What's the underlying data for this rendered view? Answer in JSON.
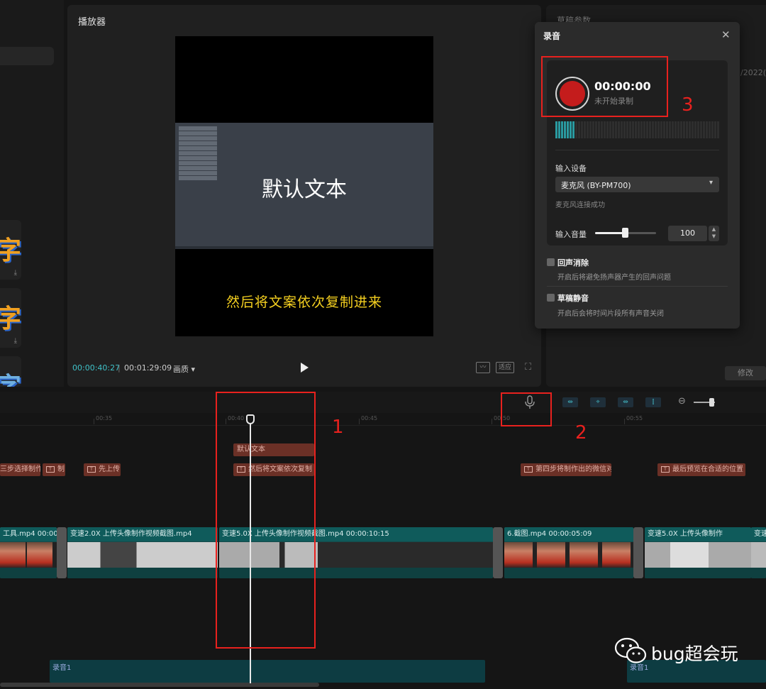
{
  "player": {
    "title": "播放器",
    "default_text": "默认文本",
    "subtitle": "然后将文案依次复制进来",
    "current_time": "00:00:40:27",
    "time_sep": "|",
    "total_time": "00:01:29:09",
    "quality_label": "画质 ▾",
    "ratio_label": "适应"
  },
  "right_panel": {
    "title": "草稿参数",
    "date_fragment": "/2022(",
    "modify_label": "修改"
  },
  "record_dialog": {
    "title": "录音",
    "close_glyph": "✕",
    "timer": "00:00:00",
    "status": "未开始录制",
    "input_device_label": "输入设备",
    "device_value": "麦克风 (BY-PM700)",
    "device_status": "麦克风连接成功",
    "volume_label": "输入音量",
    "volume_value": "100",
    "volume_level": 0.5,
    "echo_cancel_label": "回声消除",
    "echo_cancel_desc": "开启后将避免扬声器产生的回声问题",
    "mute_label": "草稿静音",
    "mute_desc": "开启后会将时间片段所有声音关闭"
  },
  "timeline": {
    "ruler_labels": [
      "00:35",
      "00:40",
      "00:45",
      "00:50",
      "00:55"
    ],
    "text_clips": {
      "default_text": "默认文本",
      "step3": "三步选择制作",
      "zhi": "制",
      "upload_first": "先上传",
      "copy_in": "然后将文案依次复制",
      "step4": "第四步将制作出的微信对",
      "preview": "最后预览在合适的位置"
    },
    "video_clips": {
      "c1": "工具.mp4   00:00",
      "c2": "变速2.0X   上传头像制作视频截图.mp4",
      "c3": "变速5.0X   上传头像制作视频截图.mp4   00:00:10:15",
      "c4": "6.截图.mp4   00:00:05:09",
      "c5": "变速5.0X   上传头像制作",
      "c6": "变速"
    },
    "audio_label_1": "录音1",
    "audio_label_2": "录音1"
  },
  "annotations": {
    "n1": "1",
    "n2": "2",
    "n3": "3"
  },
  "watermark": {
    "text": "bug超会玩"
  },
  "colors": {
    "accent_cyan": "#3fc2c9",
    "record_red": "#c41c1c",
    "highlight_red": "#e8211e",
    "subtitle_yellow": "#f5d020"
  }
}
